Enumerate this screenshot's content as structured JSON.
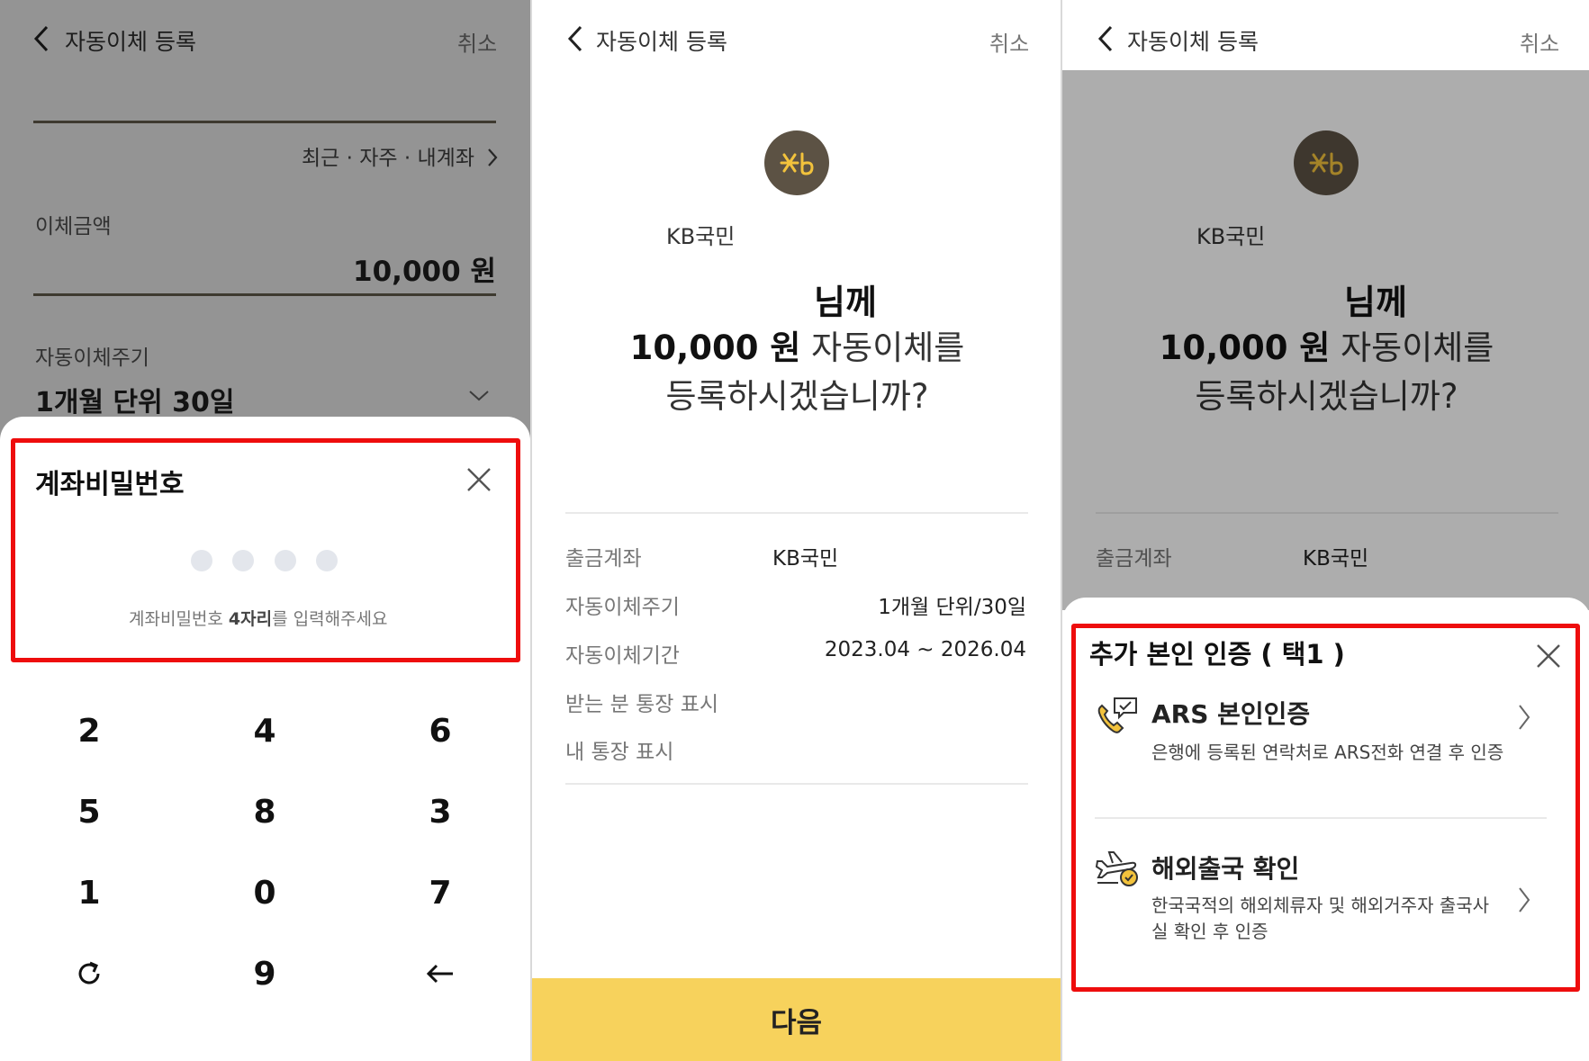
{
  "header": {
    "title": "자동이체 등록",
    "cancel_label": "취소"
  },
  "panel1": {
    "recent_links": "최근 · 자주 · 내계좌",
    "amount_label": "이체금액",
    "amount_value": "10,000 원",
    "cycle_label": "자동이체주기",
    "cycle_value": "1개월 단위 30일",
    "sheet": {
      "title": "계좌비밀번호",
      "hint_prefix": "계좌비밀번호 ",
      "hint_bold": "4자리",
      "hint_suffix": "를 입력해주세요"
    },
    "keypad": [
      "2",
      "4",
      "6",
      "5",
      "8",
      "3",
      "1",
      "0",
      "7",
      "refresh-icon",
      "9",
      "backspace-icon"
    ]
  },
  "panel2": {
    "bank_name": "KB국민",
    "recipient_suffix": "님께",
    "amount_bold": "10,000 원",
    "amount_rest": " 자동이체를",
    "question": "등록하시겠습니까?",
    "rows": [
      {
        "label": "출금계좌",
        "value": "KB국민"
      },
      {
        "label": "자동이체주기",
        "value": "1개월 단위/30일"
      },
      {
        "label": "자동이체기간",
        "value": "2023.04 ~ 2026.04"
      },
      {
        "label": "받는 분 통장 표시",
        "value": ""
      },
      {
        "label": "내 통장 표시",
        "value": ""
      }
    ],
    "next_label": "다음"
  },
  "panel3": {
    "bank_name": "KB국민",
    "recipient_suffix": "님께",
    "amount_bold": "10,000 원",
    "amount_rest": " 자동이체를",
    "question": "등록하시겠습니까?",
    "row_label": "출금계좌",
    "row_value": "KB국민",
    "sheet": {
      "title": "추가 본인 인증 ( 택1 )",
      "options": [
        {
          "title": "ARS 본인인증",
          "desc": "은행에 등록된 연락처로 ARS전화 연결 후 인증",
          "icon": "phone-chat-icon"
        },
        {
          "title": "해외출국 확인",
          "desc": "한국국적의 해외체류자 및 해외거주자 출국사실 확인 후 인증",
          "icon": "airplane-check-icon"
        }
      ]
    }
  },
  "colors": {
    "accent_yellow": "#f7d25c",
    "kb_brown": "#5c5244",
    "highlight_red": "#ee0d0d"
  }
}
